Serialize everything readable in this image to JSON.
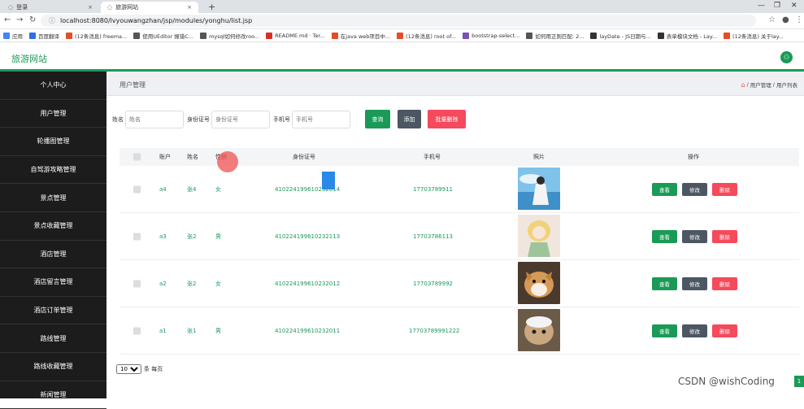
{
  "browser": {
    "tabs": [
      {
        "label": "登录",
        "active": false
      },
      {
        "label": "旅游网站",
        "active": true
      }
    ],
    "new_tab": "+",
    "url": "localhost:8080/lvyouwangzhan/jsp/modules/yonghu/list.jsp",
    "bookmarks": [
      {
        "label": "应用",
        "color": "#4285f4"
      },
      {
        "label": "百度翻译",
        "color": "#2d6ee6"
      },
      {
        "label": "(12条消息) freema...",
        "color": "#e44d26"
      },
      {
        "label": "使用UEditor 报错C...",
        "color": "#555555"
      },
      {
        "label": "mysql如何修改roo...",
        "color": "#555555"
      },
      {
        "label": "README.md · Ter...",
        "color": "#d93025"
      },
      {
        "label": "在java web项目中...",
        "color": "#e44d26"
      },
      {
        "label": "(12条消息) root of...",
        "color": "#e44d26"
      },
      {
        "label": "bootstrap-select...",
        "color": "#7952b3"
      },
      {
        "label": "如何用正则匹配: 2...",
        "color": "#555555"
      },
      {
        "label": "layDate - JS日期与...",
        "color": "#333333"
      },
      {
        "label": "表单模块文档 - Lay...",
        "color": "#333333"
      },
      {
        "label": "(12条消息) 关于lay...",
        "color": "#e44d26"
      }
    ]
  },
  "app": {
    "brand": "旅游网站",
    "accent": "#1a9a56"
  },
  "sidebar": {
    "items": [
      "个人中心",
      "用户管理",
      "轮播图管理",
      "自驾游攻略管理",
      "景点管理",
      "景点收藏管理",
      "酒店管理",
      "酒店留言管理",
      "酒店订单管理",
      "路线管理",
      "路线收藏管理",
      "新闻管理"
    ]
  },
  "page": {
    "title": "用户管理",
    "breadcrumb": [
      "用户管理",
      "用户列表"
    ],
    "breadcrumb_sep": "/"
  },
  "search": {
    "name_label": "姓名",
    "name_placeholder": "姓名",
    "id_label": "身份证号",
    "id_placeholder": "身份证号",
    "phone_label": "手机号",
    "phone_placeholder": "手机号"
  },
  "buttons": {
    "query": "查询",
    "add": "添加",
    "bulk_delete": "批量删除",
    "view": "查看",
    "edit": "修改",
    "delete": "删除"
  },
  "table": {
    "headers": [
      "账户",
      "姓名",
      "性别",
      "身份证号",
      "手机号",
      "照片",
      "操作"
    ],
    "rows": [
      {
        "account": "a4",
        "name": "张4",
        "gender": "女",
        "id_number": "410224199610232014",
        "phone": "17703789911",
        "photo": "photo-anime-boy"
      },
      {
        "account": "a3",
        "name": "张2",
        "gender": "男",
        "id_number": "410224199610232113",
        "phone": "17703786113",
        "photo": "photo-doll"
      },
      {
        "account": "a2",
        "name": "张2",
        "gender": "女",
        "id_number": "410224199610232012",
        "phone": "17703789992",
        "photo": "photo-shiba-dog"
      },
      {
        "account": "a1",
        "name": "张1",
        "gender": "男",
        "id_number": "410224199610232011",
        "phone": "17703789991222",
        "photo": "photo-cat"
      }
    ]
  },
  "pager": {
    "page_size": "10",
    "suffix": "条 每页"
  },
  "watermark": "CSDN @wishCoding",
  "corner_badge": "1"
}
